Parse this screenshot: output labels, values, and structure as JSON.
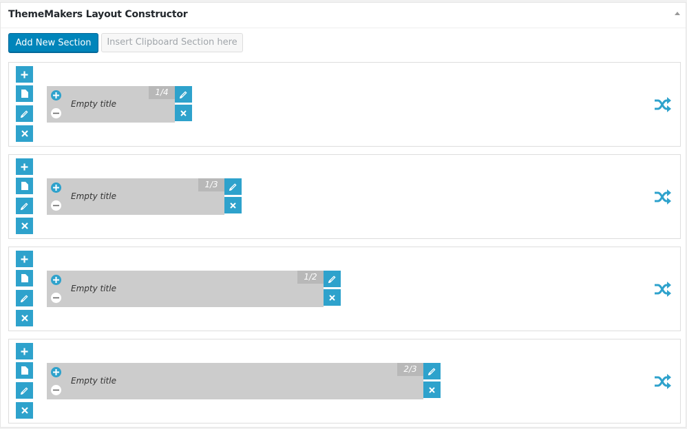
{
  "header": {
    "title": "ThemeMakers Layout Constructor"
  },
  "toolbar": {
    "add_label": "Add New Section",
    "clipboard_label": "Insert Clipboard Section here"
  },
  "colors": {
    "accent": "#2ea2cc",
    "primary_button": "#0085ba",
    "column_bg": "#cccccc"
  },
  "section_controls": [
    "plus-icon",
    "document-icon",
    "pencil-icon",
    "close-icon"
  ],
  "sections": [
    {
      "column": {
        "title": "Empty title",
        "size": "1/4"
      }
    },
    {
      "column": {
        "title": "Empty title",
        "size": "1/3"
      }
    },
    {
      "column": {
        "title": "Empty title",
        "size": "1/2"
      }
    },
    {
      "column": {
        "title": "Empty title",
        "size": "2/3"
      }
    }
  ]
}
